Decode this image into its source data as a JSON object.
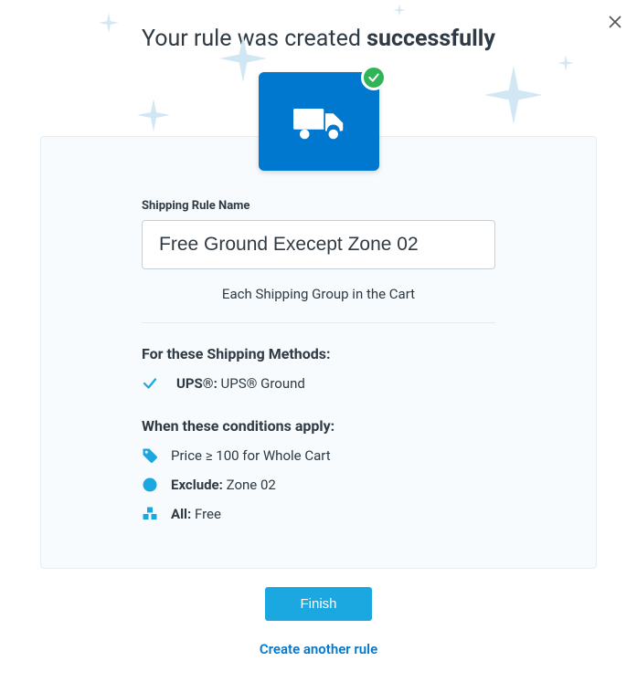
{
  "header": {
    "prefix": "Your rule was created ",
    "emphasis": "successfully"
  },
  "form": {
    "name_label": "Shipping Rule Name",
    "name_value": "Free Ground Execept Zone 02",
    "scope_caption": "Each Shipping Group in the Cart"
  },
  "methods": {
    "heading": "For these Shipping Methods:",
    "items": [
      {
        "carrier": "UPS®:",
        "service": " UPS® Ground"
      }
    ]
  },
  "conditions": {
    "heading": "When these conditions apply:",
    "price": {
      "text": "Price ≥ 100 for Whole Cart"
    },
    "exclude": {
      "label": "Exclude:",
      "value": " Zone 02"
    },
    "all": {
      "label": "All:",
      "value": " Free"
    }
  },
  "actions": {
    "finish": "Finish",
    "create_another": "Create another rule"
  }
}
